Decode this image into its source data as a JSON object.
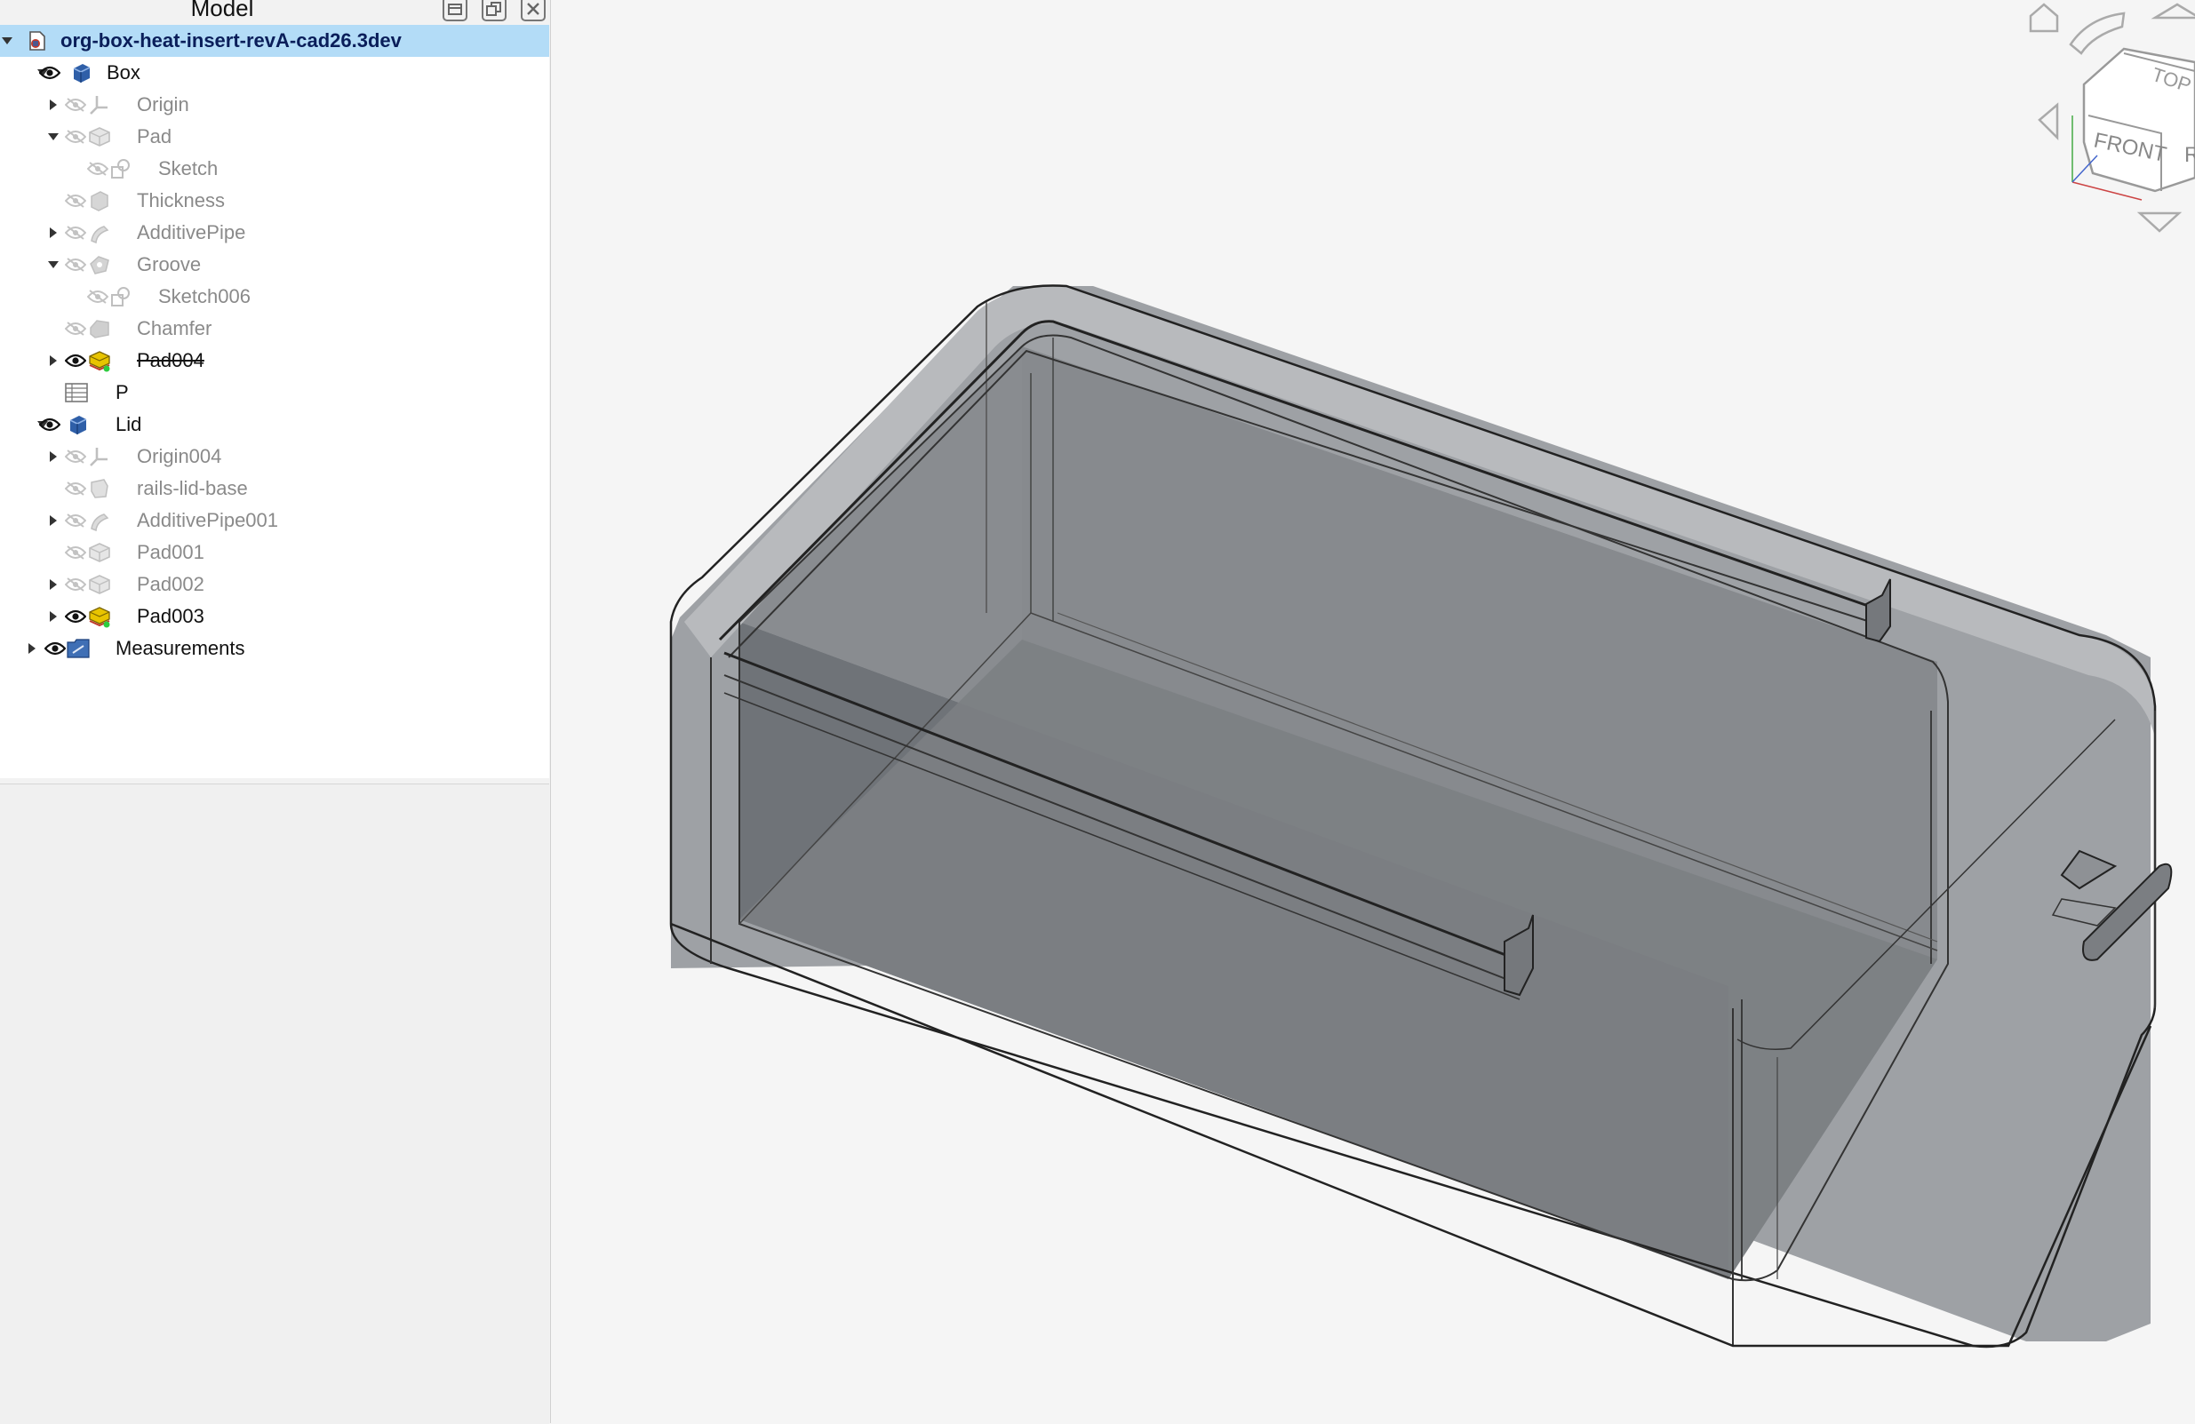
{
  "panel": {
    "title": "Model"
  },
  "tree": {
    "root_label": "org-box-heat-insert-revA-cad26.3dev",
    "items": [
      {
        "label": "Box",
        "icon": "body-icon"
      },
      {
        "label": "Origin",
        "icon": "origin-icon"
      },
      {
        "label": "Pad",
        "icon": "pad-icon"
      },
      {
        "label": "Sketch",
        "icon": "sketch-icon"
      },
      {
        "label": "Thickness",
        "icon": "thickness-icon"
      },
      {
        "label": "AdditivePipe",
        "icon": "additive-pipe-icon"
      },
      {
        "label": "Groove",
        "icon": "groove-icon"
      },
      {
        "label": "Sketch006",
        "icon": "sketch-icon"
      },
      {
        "label": "Chamfer",
        "icon": "chamfer-icon"
      },
      {
        "label": "Pad004",
        "icon": "pad-icon"
      },
      {
        "label": "P",
        "icon": "spreadsheet-icon"
      },
      {
        "label": "Lid",
        "icon": "body-icon"
      },
      {
        "label": "Origin004",
        "icon": "origin-icon"
      },
      {
        "label": "rails-lid-base",
        "icon": "shapebinder-icon"
      },
      {
        "label": "AdditivePipe001",
        "icon": "additive-pipe-icon"
      },
      {
        "label": "Pad001",
        "icon": "pad-icon"
      },
      {
        "label": "Pad002",
        "icon": "pad-icon"
      },
      {
        "label": "Pad003",
        "icon": "pad-icon"
      },
      {
        "label": "Measurements",
        "icon": "measurement-group-icon"
      }
    ]
  },
  "navcube": {
    "top_label": "TOP",
    "front_label": "FRONT",
    "right_label": "R"
  },
  "colors": {
    "selection": "#b3dcf7",
    "viewport_bg": "#f5f5f5",
    "part_fill": "#6f7378",
    "body_icon": "#2f5fa8",
    "pad_active_icon": "#e8c400"
  }
}
